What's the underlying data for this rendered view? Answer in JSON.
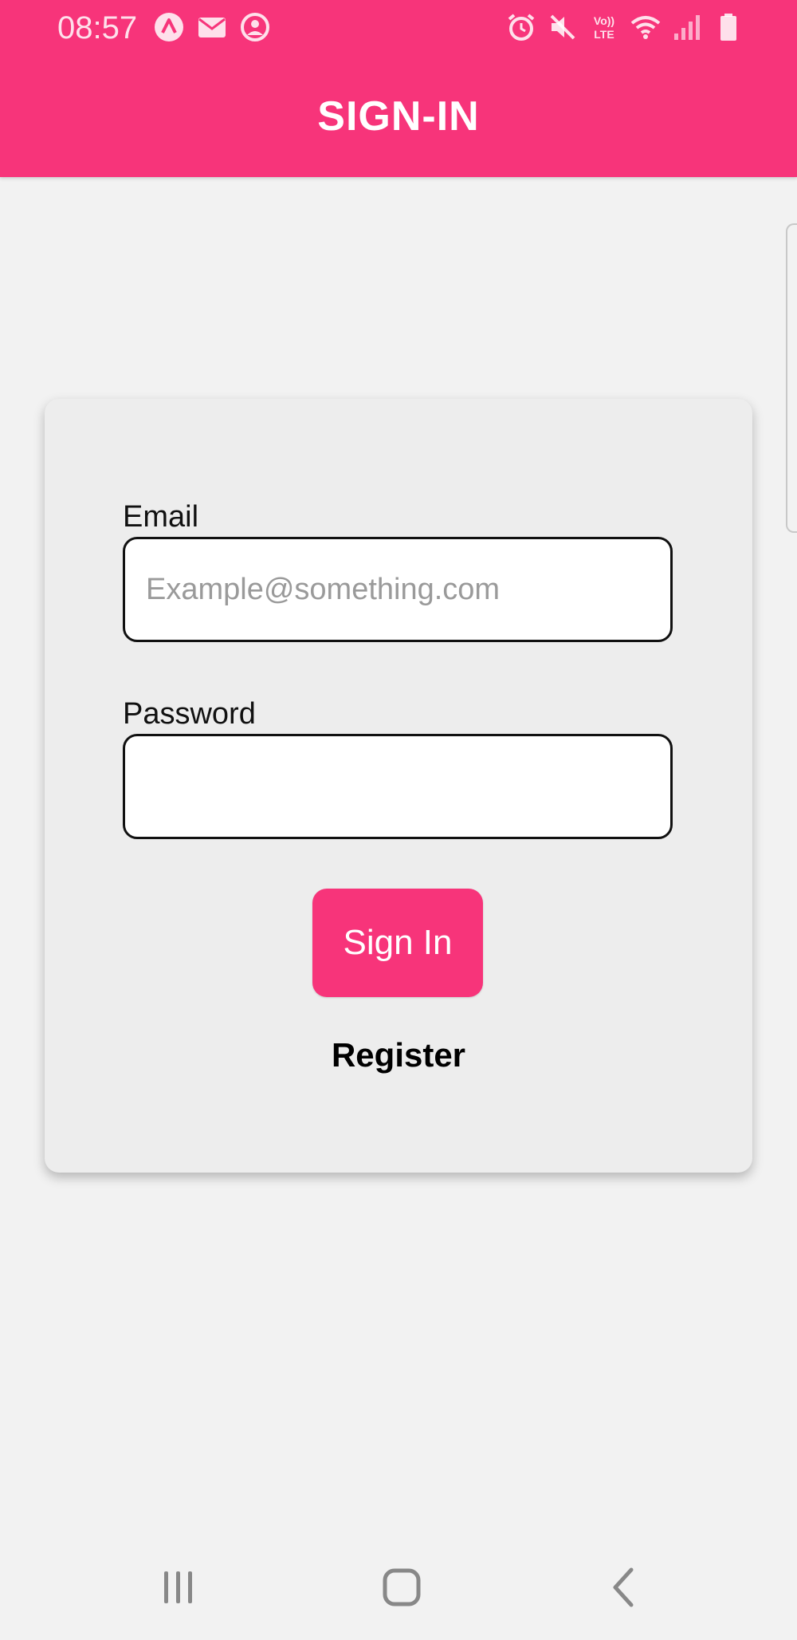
{
  "status_bar": {
    "time": "08:57",
    "left_icons": [
      "app-notification-icon",
      "mail-icon",
      "account-circle-icon"
    ],
    "right_icons": [
      "alarm-icon",
      "mute-icon",
      "volte-icon",
      "wifi-icon",
      "signal-icon",
      "battery-icon"
    ],
    "volte_label_top": "Vo))",
    "volte_label_bottom": "LTE"
  },
  "header": {
    "title": "SIGN-IN",
    "background_color": "#f7347a"
  },
  "form": {
    "email_label": "Email",
    "email_placeholder": "Example@something.com",
    "email_value": "",
    "password_label": "Password",
    "password_value": "",
    "signin_label": "Sign In",
    "register_label": "Register"
  },
  "nav_bar": {
    "icons": [
      "recent-apps-icon",
      "home-icon",
      "back-icon"
    ]
  },
  "colors": {
    "accent": "#f7347a",
    "page_bg": "#f2f2f2",
    "card_bg": "#ededed"
  }
}
